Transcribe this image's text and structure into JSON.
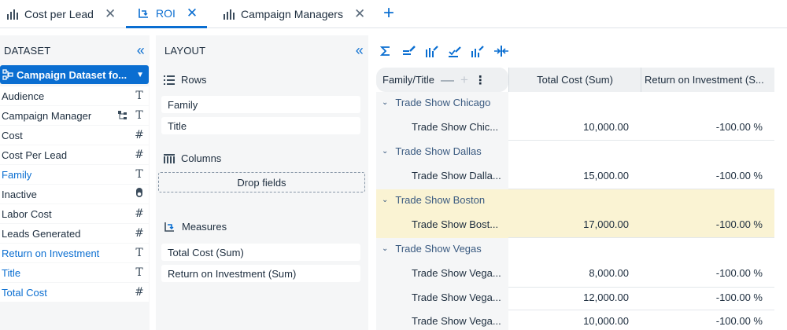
{
  "tabs": [
    {
      "label": "Cost per Lead",
      "icon": "bar-chart-icon"
    },
    {
      "label": "ROI",
      "icon": "pivot-icon",
      "active": true
    },
    {
      "label": "Campaign Managers",
      "icon": "bar-chart-icon"
    }
  ],
  "dataset": {
    "title": "DATASET",
    "selected": "Campaign Dataset fo...",
    "fields": [
      {
        "label": "Audience",
        "type": "T"
      },
      {
        "label": "Campaign Manager",
        "type": "T"
      },
      {
        "label": "Cost",
        "type": "#"
      },
      {
        "label": "Cost Per Lead",
        "type": "#"
      },
      {
        "label": "Family",
        "type": "T"
      },
      {
        "label": "Inactive",
        "type": "toggle"
      },
      {
        "label": "Labor Cost",
        "type": "#"
      },
      {
        "label": "Leads Generated",
        "type": "#"
      },
      {
        "label": "Return on Investment",
        "type": "T"
      },
      {
        "label": "Title",
        "type": "T"
      },
      {
        "label": "Total Cost",
        "type": "#"
      }
    ]
  },
  "layout": {
    "title": "LAYOUT",
    "rows_label": "Rows",
    "rows": [
      "Family",
      "Title"
    ],
    "columns_label": "Columns",
    "drop_label": "Drop fields",
    "measures_label": "Measures",
    "measures": [
      "Total Cost (Sum)",
      "Return on Investment (Sum)"
    ]
  },
  "table": {
    "corner_label": "Family/Title",
    "col1": "Total Cost (Sum)",
    "col2": "Return on Investment (S...",
    "groups": [
      {
        "name": "Trade Show Chicago",
        "rows": [
          {
            "title": "Trade Show Chic...",
            "cost": "10,000.00",
            "roi": "-100.00 %"
          }
        ]
      },
      {
        "name": "Trade Show Dallas",
        "rows": [
          {
            "title": "Trade Show Dalla...",
            "cost": "15,000.00",
            "roi": "-100.00 %"
          }
        ]
      },
      {
        "name": "Trade Show Boston",
        "rows": [
          {
            "title": "Trade Show Bost...",
            "cost": "17,000.00",
            "roi": "-100.00 %"
          }
        ]
      },
      {
        "name": "Trade Show Vegas",
        "rows": [
          {
            "title": "Trade Show Vega...",
            "cost": "8,000.00",
            "roi": "-100.00 %"
          },
          {
            "title": "Trade Show Vega...",
            "cost": "12,000.00",
            "roi": "-100.00 %"
          },
          {
            "title": "Trade Show Vega...",
            "cost": "10,000.00",
            "roi": "-100.00 %"
          }
        ]
      }
    ]
  },
  "colors": {
    "accent": "#0a6ed1",
    "highlight": "#faf3d3",
    "panel": "#f5f6f7"
  }
}
